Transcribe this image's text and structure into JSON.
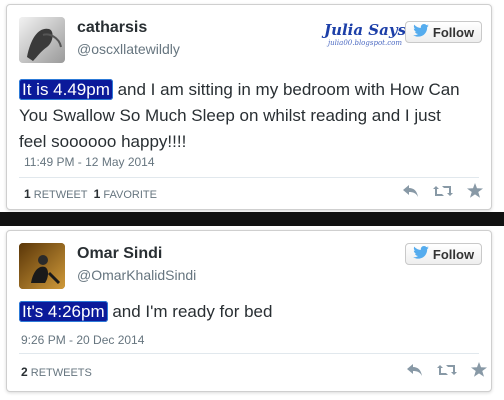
{
  "tweets": [
    {
      "name": "catharsis",
      "handle": "@oscxllatewildly",
      "follow_label": "Follow",
      "text_highlight": "It is 4.49pm",
      "text_rest_line1": " and I am sitting in my bedroom with How Can",
      "text_line2": "You Swallow So Much Sleep on whilst reading and I just",
      "text_line3": "feel soooooo happy!!!!",
      "timestamp": "11:49 PM - 12 May 2014",
      "retweet_count": "1",
      "retweet_label": "RETWEET",
      "favorite_count": "1",
      "favorite_label": "FAVORITE"
    },
    {
      "name": "Omar Sindi",
      "handle": "@OmarKhalidSindi",
      "follow_label": "Follow",
      "text_highlight": "It's 4:26pm",
      "text_rest_line1": " and I'm ready for bed",
      "timestamp": "9:26 PM - 20 Dec 2014",
      "retweet_count": "2",
      "retweet_label": "RETWEETS"
    }
  ],
  "watermark": {
    "title": "Julia Says",
    "subtitle": "julia00.blogspot.com"
  },
  "icons": {
    "follow": "twitter-bird-icon",
    "reply": "reply-icon",
    "retweet": "retweet-icon",
    "favorite": "star-icon"
  },
  "colors": {
    "highlight_bg": "#0b1a9a",
    "twitter_blue": "#55acee",
    "action_gray": "#8899a6"
  }
}
